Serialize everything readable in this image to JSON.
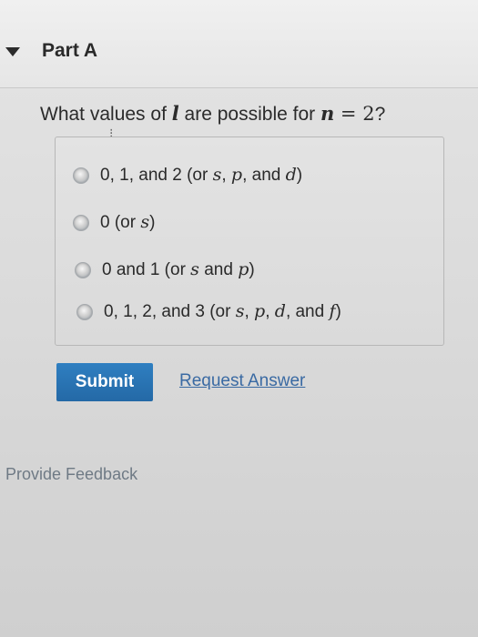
{
  "part": {
    "title": "Part A"
  },
  "question": {
    "prefix": "What values of ",
    "var_l": "l",
    "middle": " are possible for ",
    "var_n": "n",
    "equals": " = ",
    "value": "2",
    "suffix": "?"
  },
  "options": [
    {
      "text_a": "0, 1, and 2 (or ",
      "s": "s",
      "sep1": ", ",
      "p": "p",
      "sep2": ", and ",
      "d": "d",
      "end": ")"
    },
    {
      "text_a": "0 (or ",
      "s": "s",
      "end": ")"
    },
    {
      "text_a": "0 and 1 (or ",
      "s": "s",
      "sep1": " and ",
      "p": "p",
      "end": ")"
    },
    {
      "text_a": "0, 1, 2, and 3 (or ",
      "s": "s",
      "sep1": ", ",
      "p": "p",
      "sep2": ", ",
      "d": "d",
      "sep3": ", and ",
      "f": "f",
      "end": ")"
    }
  ],
  "actions": {
    "submit_label": "Submit",
    "request_label": "Request Answer"
  },
  "feedback": {
    "label": "Provide Feedback"
  },
  "colors": {
    "submit_bg": "#2a74b5",
    "link": "#3a6aa3",
    "feedback": "#6f7a85"
  }
}
